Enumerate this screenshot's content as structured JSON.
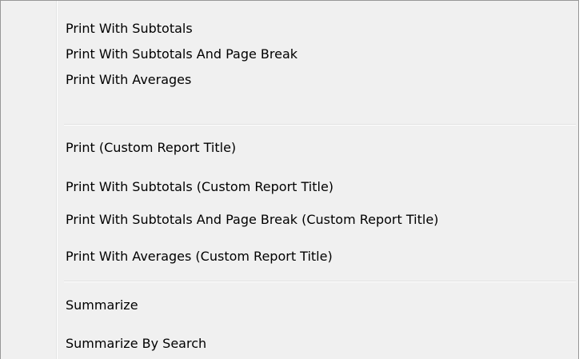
{
  "menu": {
    "groups": [
      {
        "items": [
          {
            "label": "Print With Subtotals"
          },
          {
            "label": "Print With Subtotals And Page Break"
          },
          {
            "label": "Print With Averages"
          }
        ]
      },
      {
        "items": [
          {
            "label": "Print (Custom Report Title)"
          },
          {
            "label": "Print With Subtotals (Custom Report Title)"
          },
          {
            "label": "Print With Subtotals And Page Break (Custom Report Title)"
          },
          {
            "label": "Print With Averages (Custom Report Title)"
          }
        ]
      },
      {
        "items": [
          {
            "label": "Summarize"
          },
          {
            "label": "Summarize By Search"
          }
        ]
      }
    ]
  },
  "colors": {
    "menu_background": "#f0f0f0",
    "menu_border": "#979797",
    "separator": "#e0e0e0",
    "text": "#000000"
  }
}
